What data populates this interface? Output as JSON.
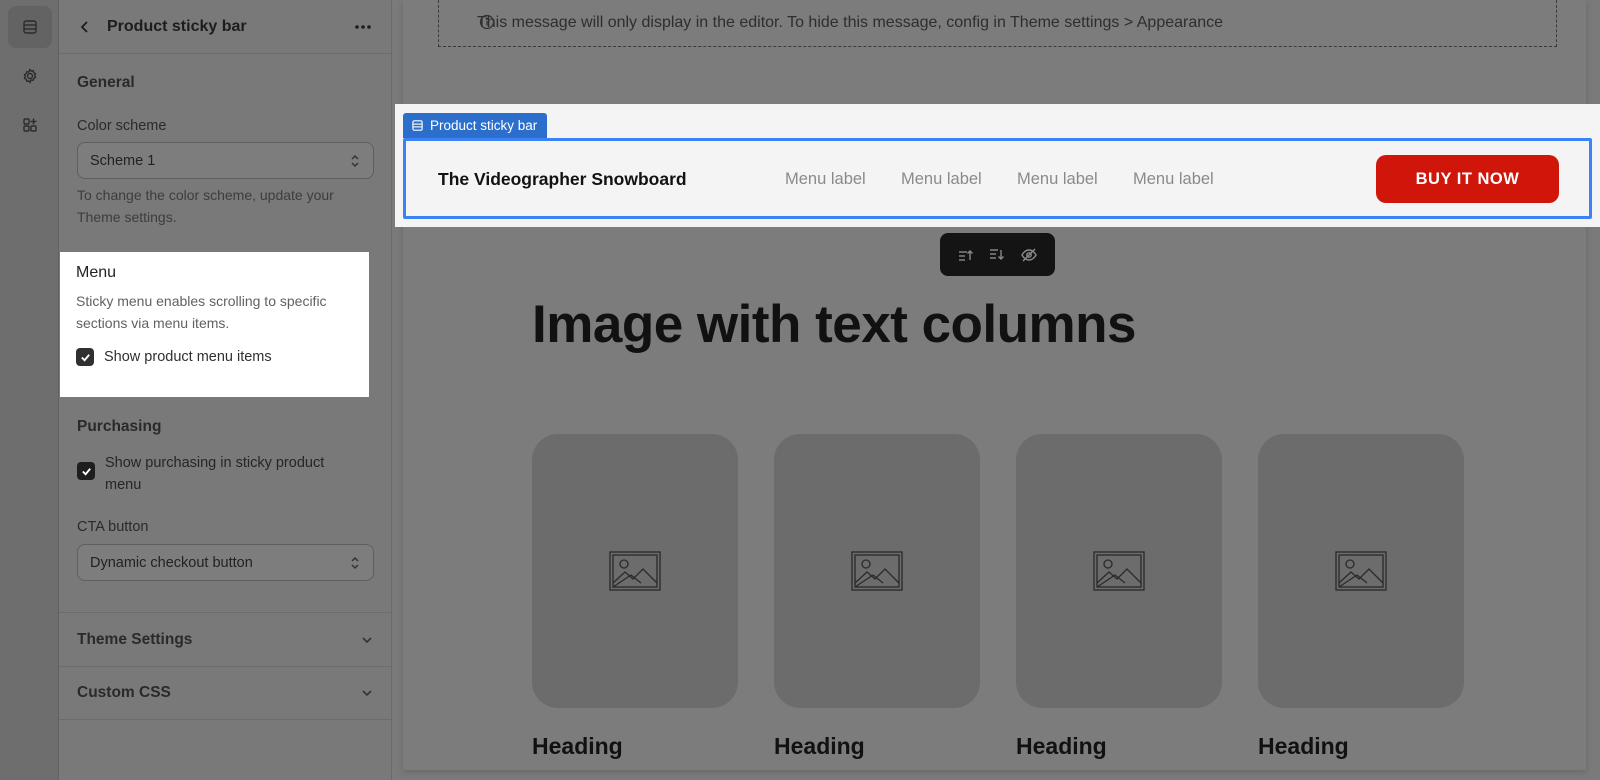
{
  "rail": {
    "items": [
      {
        "icon": "sections-icon",
        "active": true
      },
      {
        "icon": "gear-icon",
        "active": false
      },
      {
        "icon": "apps-icon",
        "active": false
      }
    ]
  },
  "panel": {
    "title": "Product sticky bar",
    "general": {
      "title": "General",
      "color_scheme_label": "Color scheme",
      "color_scheme_value": "Scheme 1",
      "color_scheme_help": "To change the color scheme, update your Theme settings."
    },
    "menu": {
      "title": "Menu",
      "help": "Sticky menu enables scrolling to specific sections via menu items.",
      "show_items_label": "Show product menu items",
      "show_items_checked": true
    },
    "purchasing": {
      "title": "Purchasing",
      "show_purchasing_label": "Show purchasing in sticky product menu",
      "show_purchasing_checked": true,
      "cta_label": "CTA button",
      "cta_value": "Dynamic checkout button"
    },
    "theme_settings": "Theme Settings",
    "custom_css": "Custom CSS"
  },
  "preview": {
    "editor_message": "This message will only display in the editor. To hide this message, config in Theme settings > Appearance",
    "sticky_tag": "Product sticky bar",
    "product_name": "The Videographer Snowboard",
    "menu_labels": [
      "Menu label",
      "Menu label",
      "Menu label",
      "Menu label"
    ],
    "buy_button": "BUY IT NOW",
    "buy_button_color": "#d0150a",
    "section_heading": "Image with text columns",
    "columns": [
      {
        "heading": "Heading"
      },
      {
        "heading": "Heading"
      },
      {
        "heading": "Heading"
      },
      {
        "heading": "Heading"
      }
    ]
  },
  "colors": {
    "accent": "#2c6ecb",
    "selection_border": "#3b82f6"
  }
}
